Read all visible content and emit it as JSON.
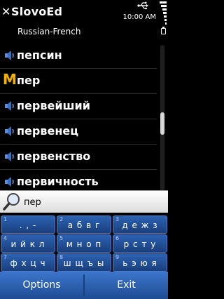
{
  "header": {
    "close_glyph": "✕",
    "app_title": "SlovoEd",
    "time": "10:00 AM",
    "dictionary": "Russian-French"
  },
  "list": {
    "items": [
      {
        "word": "пепсин",
        "icon": "speaker-icon"
      },
      {
        "word": "пер",
        "icon": "m-icon",
        "icon_text": "M"
      },
      {
        "word": "первейший",
        "icon": "speaker-icon"
      },
      {
        "word": "первенец",
        "icon": "speaker-icon"
      },
      {
        "word": "первенство",
        "icon": "speaker-icon"
      },
      {
        "word": "первичность",
        "icon": "speaker-icon"
      }
    ]
  },
  "search": {
    "value": "пер",
    "placeholder": ""
  },
  "keypad": {
    "keys": [
      {
        "num": "1",
        "chars": ". , -"
      },
      {
        "num": "2",
        "chars": "а б в г"
      },
      {
        "num": "3",
        "chars": "д е ж з"
      },
      {
        "num": "4",
        "chars": "и й к л"
      },
      {
        "num": "5",
        "chars": "м н о п"
      },
      {
        "num": "6",
        "chars": "р с т у"
      },
      {
        "num": "7",
        "chars": "ф х ц ч"
      },
      {
        "num": "8",
        "chars": "ш щ ъ ы"
      },
      {
        "num": "9",
        "chars": "ь э ю я"
      }
    ]
  },
  "softkeys": {
    "left": "Options",
    "right": "Exit"
  },
  "colors": {
    "accent": "#2c62b3",
    "highlight_icon": "#f0b000"
  }
}
